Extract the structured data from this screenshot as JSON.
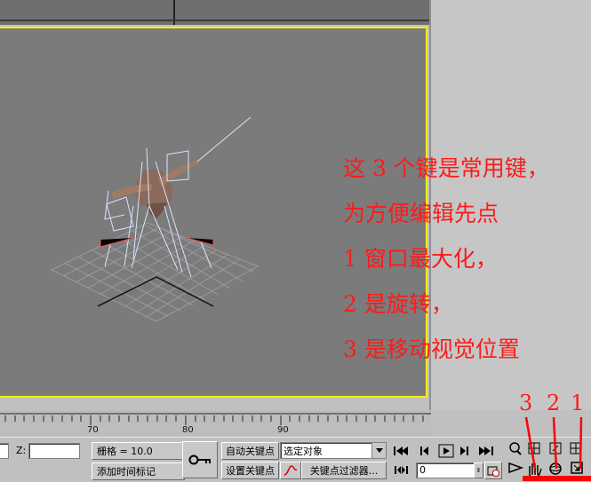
{
  "annotation": {
    "lines": [
      "这 3 个键是常用键，",
      "为方便编辑先点",
      "1 窗口最大化，",
      "2 是旋转，",
      "3 是移动视觉位置"
    ]
  },
  "timeline": {
    "ticks": [
      "70",
      "80",
      "90"
    ]
  },
  "bottom": {
    "z_label": "Z:",
    "z_value": "",
    "grid_label": "栅格 = 10.0",
    "add_time_tag": "添加时间标记",
    "auto_key": "自动关键点",
    "set_key": "设置关键点",
    "selection_dropdown": "选定对象",
    "key_filter": "关键点过滤器...",
    "frame_value": "0"
  },
  "nav_numbers": [
    "3",
    "2",
    "1"
  ],
  "colors": {
    "viewport_border": "#f3f000",
    "annotation": "#ff1a1a",
    "viewport_bg": "#7b7b7b"
  }
}
